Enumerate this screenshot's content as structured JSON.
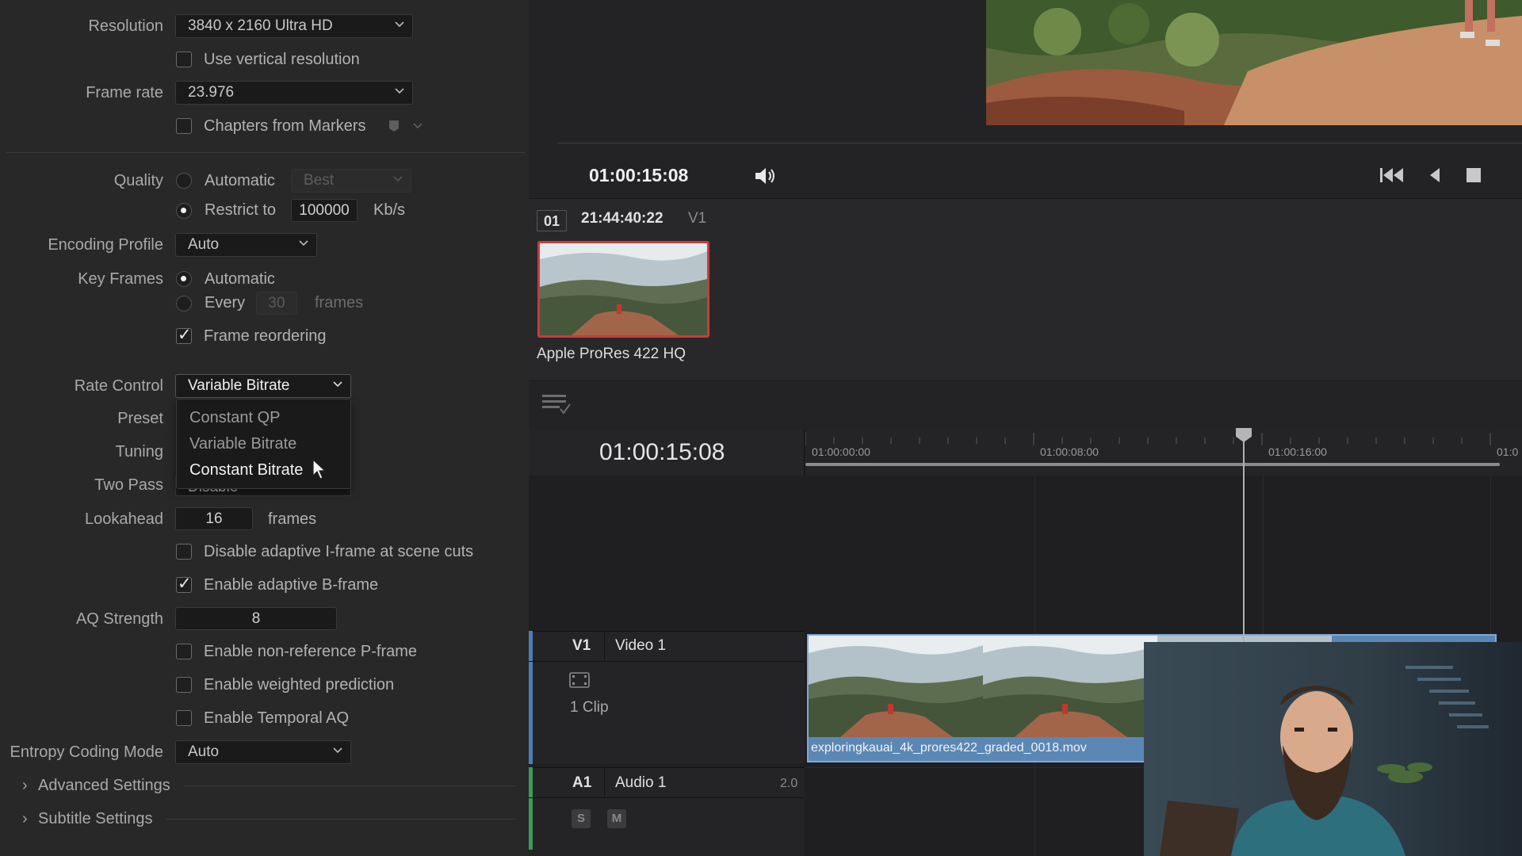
{
  "settings": {
    "resolution": {
      "label": "Resolution",
      "value": "3840 x 2160 Ultra HD"
    },
    "vertical_resolution": {
      "label": "Use vertical resolution",
      "checked": false
    },
    "frame_rate": {
      "label": "Frame rate",
      "value": "23.976"
    },
    "chapters": {
      "label": "Chapters from Markers",
      "checked": false
    },
    "quality": {
      "label": "Quality",
      "automatic_label": "Automatic",
      "automatic_value": "Best",
      "restrict_label": "Restrict to",
      "restrict_value": "100000",
      "unit": "Kb/s",
      "selected": "restrict"
    },
    "encoding_profile": {
      "label": "Encoding Profile",
      "value": "Auto"
    },
    "key_frames": {
      "label": "Key Frames",
      "automatic_label": "Automatic",
      "every_label": "Every",
      "every_value": "30",
      "unit": "frames",
      "selected": "automatic"
    },
    "frame_reordering": {
      "label": "Frame reordering",
      "checked": true
    },
    "rate_control": {
      "label": "Rate Control",
      "value": "Variable Bitrate",
      "options": [
        "Constant QP",
        "Variable Bitrate",
        "Constant Bitrate"
      ],
      "highlighted": "Constant Bitrate"
    },
    "preset_label": "Preset",
    "tuning_label": "Tuning",
    "two_pass": {
      "label": "Two Pass",
      "value": "Disable"
    },
    "lookahead": {
      "label": "Lookahead",
      "value": "16",
      "unit": "frames"
    },
    "disable_adaptive_iframe": {
      "label": "Disable adaptive I-frame at scene cuts",
      "checked": false
    },
    "enable_adaptive_bframe": {
      "label": "Enable adaptive B-frame",
      "checked": true
    },
    "aq_strength": {
      "label": "AQ Strength",
      "value": "8"
    },
    "non_reference_pframe": {
      "label": "Enable non-reference P-frame",
      "checked": false
    },
    "weighted_prediction": {
      "label": "Enable weighted prediction",
      "checked": false
    },
    "temporal_aq": {
      "label": "Enable Temporal AQ",
      "checked": false
    },
    "entropy_coding": {
      "label": "Entropy Coding Mode",
      "value": "Auto"
    },
    "advanced_settings": "Advanced Settings",
    "subtitle_settings": "Subtitle Settings"
  },
  "viewer": {
    "timecode": "01:00:15:08",
    "icons": [
      "volume-icon",
      "skip-to-start-icon",
      "play-reverse-icon",
      "stop-icon"
    ]
  },
  "clip": {
    "number": "01",
    "timecode": "21:44:40:22",
    "track": "V1",
    "codec": "Apple ProRes 422 HQ"
  },
  "timeline": {
    "timecode": "01:00:15:08",
    "ruler_labels": [
      "01:00:00:00",
      "01:00:08:00",
      "01:00:16:00",
      "01:0"
    ],
    "video_track": {
      "id": "V1",
      "name": "Video 1",
      "clip_count": "1 Clip",
      "color": "#4a7fb4"
    },
    "audio_track": {
      "id": "A1",
      "name": "Audio 1",
      "channels": "2.0",
      "solo": "S",
      "mute": "M",
      "color": "#3e9b56"
    },
    "clip_name": "exploringkauai_4k_prores422_graded_0018.mov"
  },
  "colors": {
    "accent_blue": "#5b87b5",
    "clip_border_red": "#c83c3c",
    "panel_bg": "#282829"
  }
}
